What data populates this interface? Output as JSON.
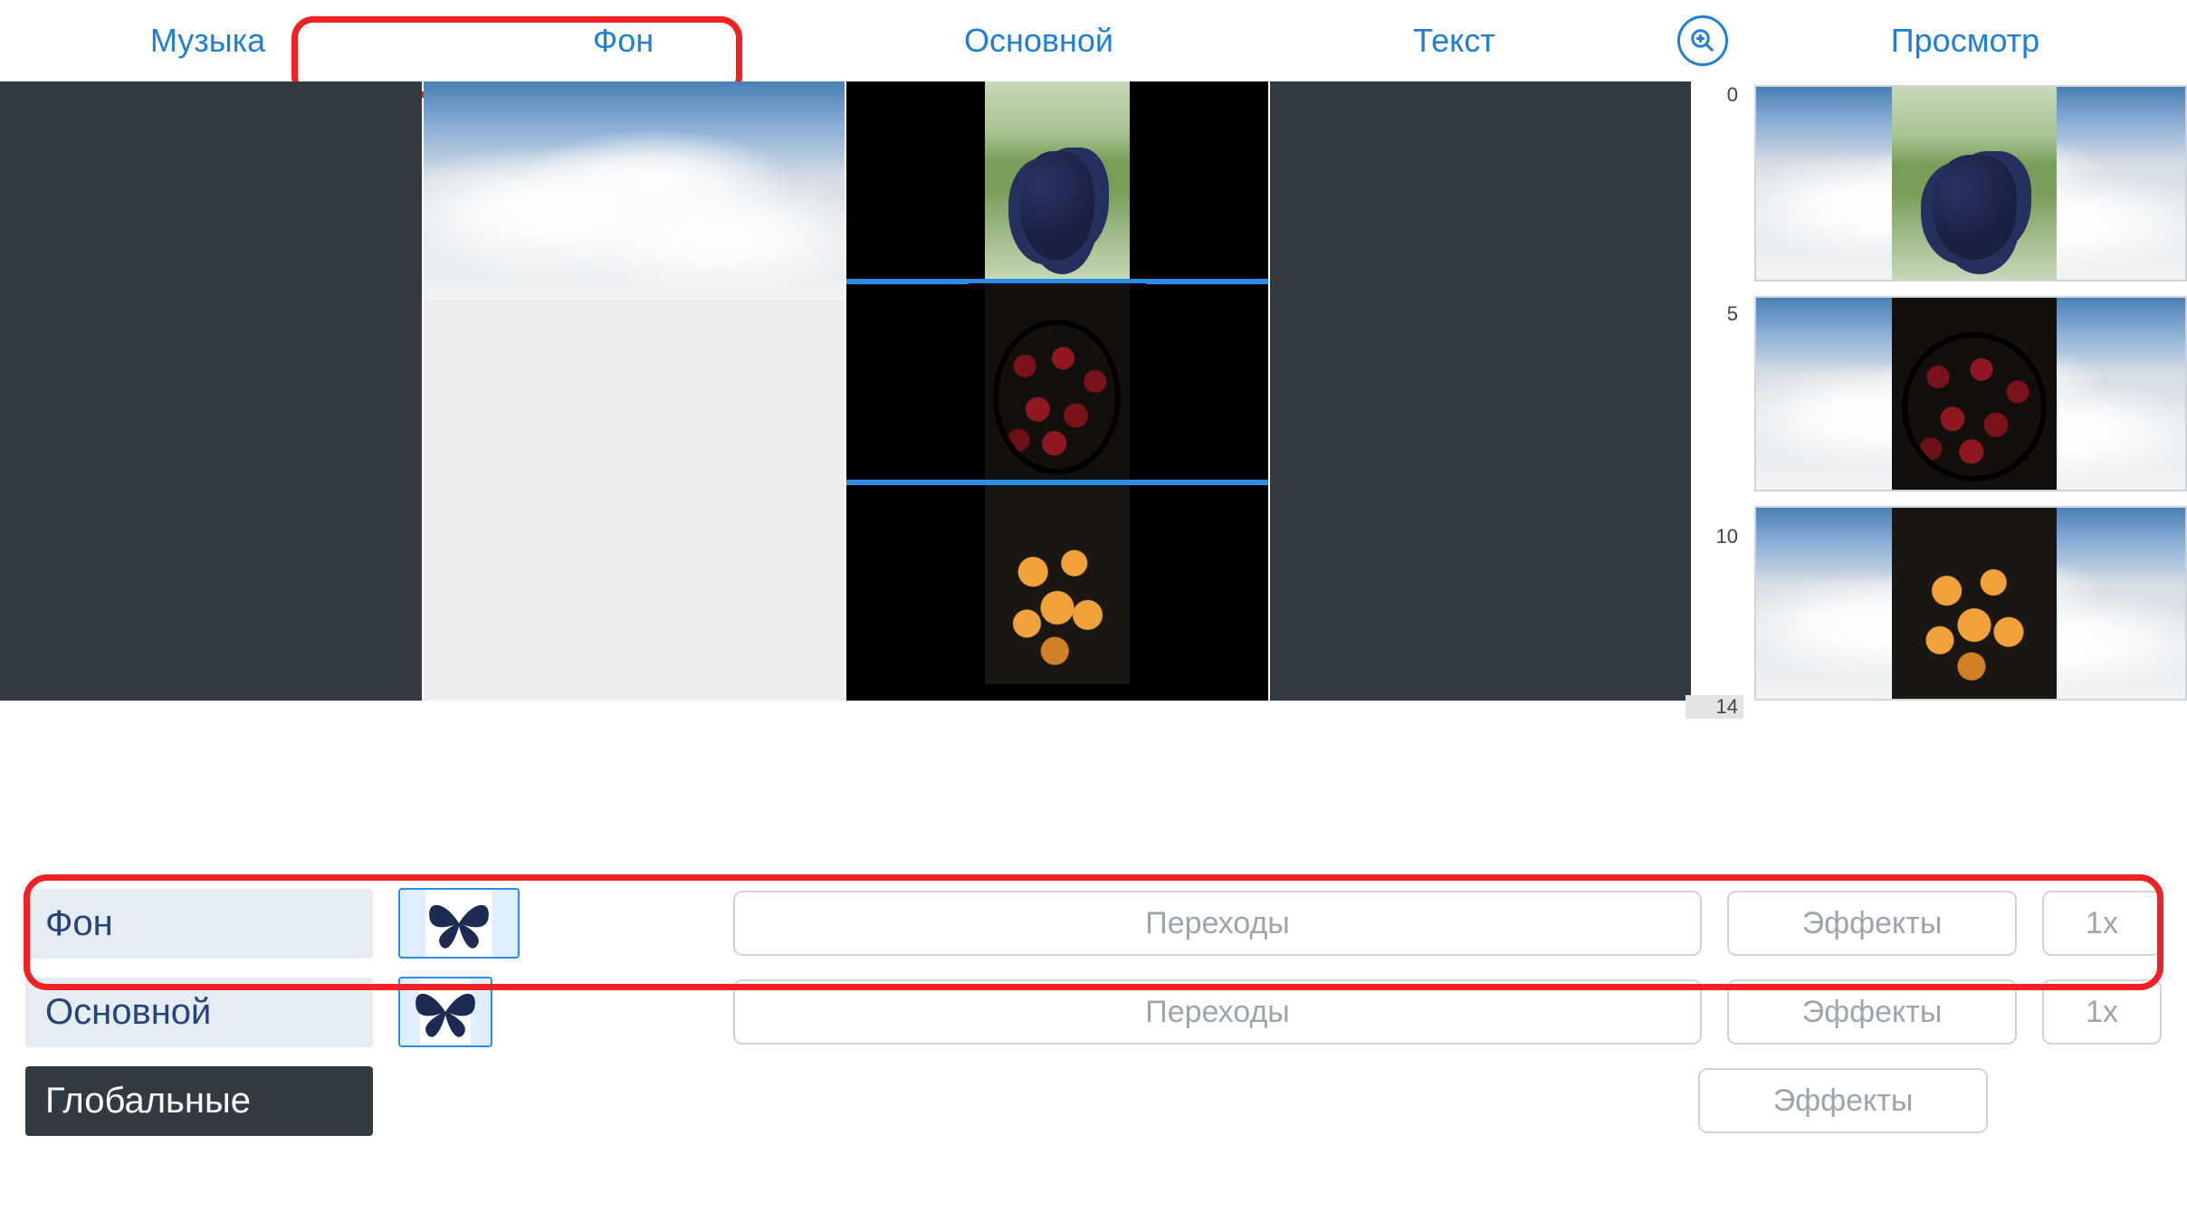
{
  "tabs": {
    "music": "Музыка",
    "background": "Фон",
    "main": "Основной",
    "text": "Текст",
    "preview": "Просмотр"
  },
  "ruler": {
    "marks": [
      "0",
      "5",
      "10"
    ],
    "active": "14"
  },
  "bottom": {
    "rows": [
      {
        "label": "Фон",
        "transitions": "Переходы",
        "effects": "Эффекты",
        "speed": "1x",
        "has_butterfly": true,
        "butterfly_wide": true,
        "has_transitions": true,
        "has_speed": true
      },
      {
        "label": "Основной",
        "transitions": "Переходы",
        "effects": "Эффекты",
        "speed": "1x",
        "has_butterfly": true,
        "butterfly_wide": false,
        "has_transitions": true,
        "has_speed": true
      },
      {
        "label": "Глобальные",
        "transitions": "",
        "effects": "Эффекты",
        "speed": "",
        "has_butterfly": false,
        "butterfly_wide": false,
        "has_transitions": false,
        "has_speed": false,
        "dark": true
      }
    ]
  },
  "icons": {
    "zoom": "zoom-icon",
    "butterfly": "butterfly-icon"
  },
  "timeline": {
    "background_clip": "clouds",
    "main_clips": [
      "grapes",
      "cherries",
      "tangerines"
    ]
  },
  "preview_thumbs": [
    "grapes",
    "cherries",
    "tangerines"
  ]
}
